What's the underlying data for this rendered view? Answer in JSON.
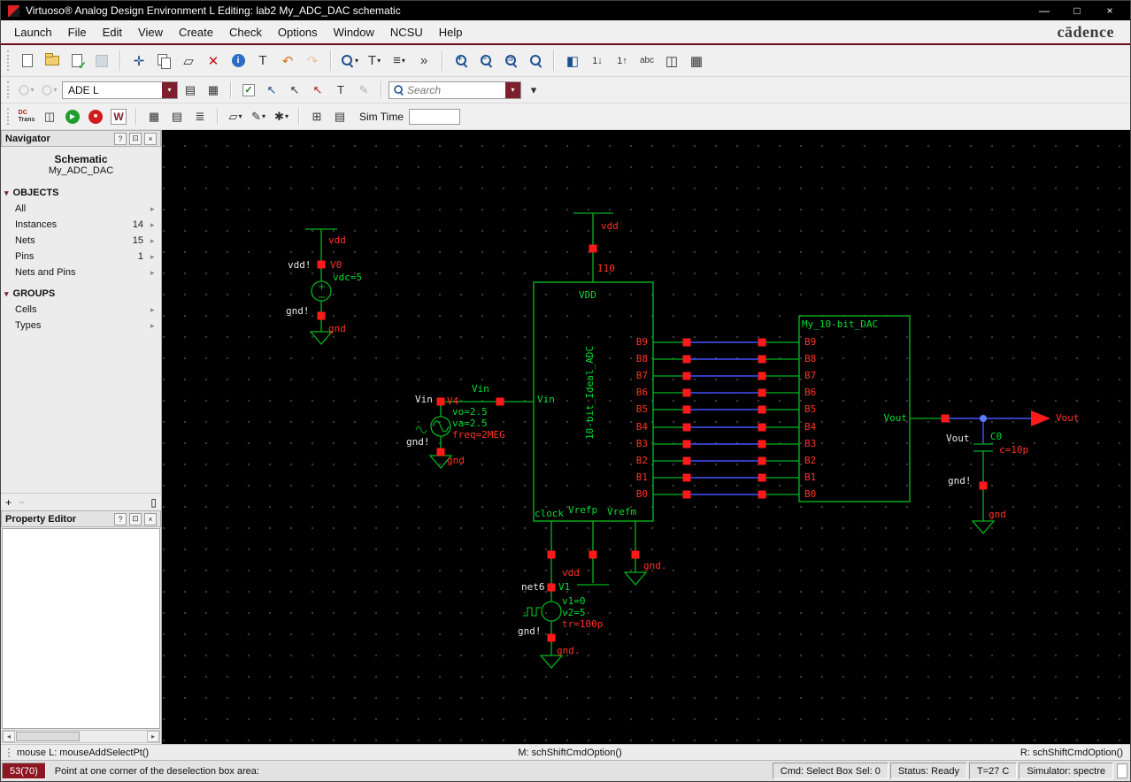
{
  "titlebar": {
    "title": "Virtuoso® Analog Design Environment L Editing: lab2 My_ADC_DAC schematic"
  },
  "menubar": {
    "items": [
      "Launch",
      "File",
      "Edit",
      "View",
      "Create",
      "Check",
      "Options",
      "Window",
      "NCSU",
      "Help"
    ],
    "brand": "cādence"
  },
  "toolbars": {
    "mode_select": "ADE L",
    "search_placeholder": "Search",
    "sim_time_label": "Sim Time",
    "adc_trans_line1": "DC",
    "adc_trans_line2": "Trans",
    "w_button": "W"
  },
  "icons": {
    "minimize": "—",
    "maximize": "□",
    "close": "×",
    "help": "?",
    "dock": "⊡",
    "move": "✛",
    "paste": "▱",
    "delete": "✕",
    "properties": "T",
    "undo": "↶",
    "redo": "↷",
    "text_tool": "T",
    "display_options": "≡",
    "more": "»",
    "plus": "+",
    "minus": "−",
    "fit": "▭",
    "hierarchy": "◧",
    "descend": "1↓",
    "ascend": "1↑",
    "abc": "abc",
    "attach": "◫",
    "grid": "▦",
    "caret": "▾",
    "chevron": "▸",
    "workspace": "▤",
    "layout": "▦",
    "check": "✓",
    "cursor": "↖",
    "pencil": "✎",
    "meter": "◫",
    "play": "▶",
    "stop": "■",
    "table": "▦",
    "report": "▤",
    "log": "≣",
    "plot": "▱",
    "asterisk": "✱",
    "calc": "⊞",
    "panel": "▯",
    "info": "i",
    "arrow_left": "◂",
    "arrow_right": "▸"
  },
  "navigator": {
    "title": "Navigator",
    "view_type": "Schematic",
    "cell_name": "My_ADC_DAC",
    "objects_header": "OBJECTS",
    "objects": [
      {
        "label": "All",
        "count": ""
      },
      {
        "label": "Instances",
        "count": "14"
      },
      {
        "label": "Nets",
        "count": "15"
      },
      {
        "label": "Pins",
        "count": "1"
      },
      {
        "label": "Nets and Pins",
        "count": ""
      }
    ],
    "groups_header": "GROUPS",
    "groups": [
      {
        "label": "Cells"
      },
      {
        "label": "Types"
      }
    ]
  },
  "property_editor": {
    "title": "Property Editor"
  },
  "schematic": {
    "v0": {
      "net_vdd": "vdd",
      "term_plus": "vdd!",
      "name": "V0",
      "dc": "vdc=5",
      "term_minus": "gnd!",
      "net_gnd": "gnd"
    },
    "v4": {
      "net": "Vin",
      "term_plus": "Vin",
      "name": "V4",
      "vo": "vo=2.5",
      "va": "va=2.5",
      "freq": "freq=2MEG",
      "term_minus": "gnd!",
      "net_gnd": "gnd"
    },
    "adc": {
      "instance": "I10",
      "net_vdd": "vdd",
      "pin_vdd": "VDD",
      "cell": "10-bit_Ideal_ADC",
      "pin_vin": "Vin",
      "bits": [
        "B9",
        "B8",
        "B7",
        "B6",
        "B5",
        "B4",
        "B3",
        "B2",
        "B1",
        "B0"
      ],
      "pin_clock": "clock",
      "pin_vrefp": "Vrefp",
      "pin_vrefm": "Vrefm"
    },
    "dac": {
      "cell": "My_10-bit_DAC",
      "bits": [
        "B9",
        "B8",
        "B7",
        "B6",
        "B5",
        "B4",
        "B3",
        "B2",
        "B1",
        "B0"
      ],
      "pin_vout": "Vout"
    },
    "vout": {
      "term": "Vout",
      "port": "Vout"
    },
    "c0": {
      "name": "C0",
      "value": "c=10p",
      "term_minus": "gnd!",
      "net_gnd": "gnd"
    },
    "v1": {
      "net": "net6",
      "name": "V1",
      "v1": "v1=0",
      "v2": "v2=5",
      "tr": "tr=100p",
      "term_minus": "gnd!",
      "net_gnd": "gnd."
    },
    "vrefp": {
      "net": "vdd"
    },
    "vrefm": {
      "net": "gnd."
    }
  },
  "statusbar": {
    "hint_left": "mouse L: mouseAddSelectPt()",
    "hint_mid": "M: schShiftCmdOption()",
    "hint_right": "R: schShiftCmdOption()",
    "counter": "53(70)",
    "prompt": "Point at one corner of the deselection box area:",
    "cmd": "Cmd: Select Box  Sel: 0",
    "status": "Status: Ready",
    "temp": "T=27 C",
    "simulator": "Simulator: spectre"
  }
}
